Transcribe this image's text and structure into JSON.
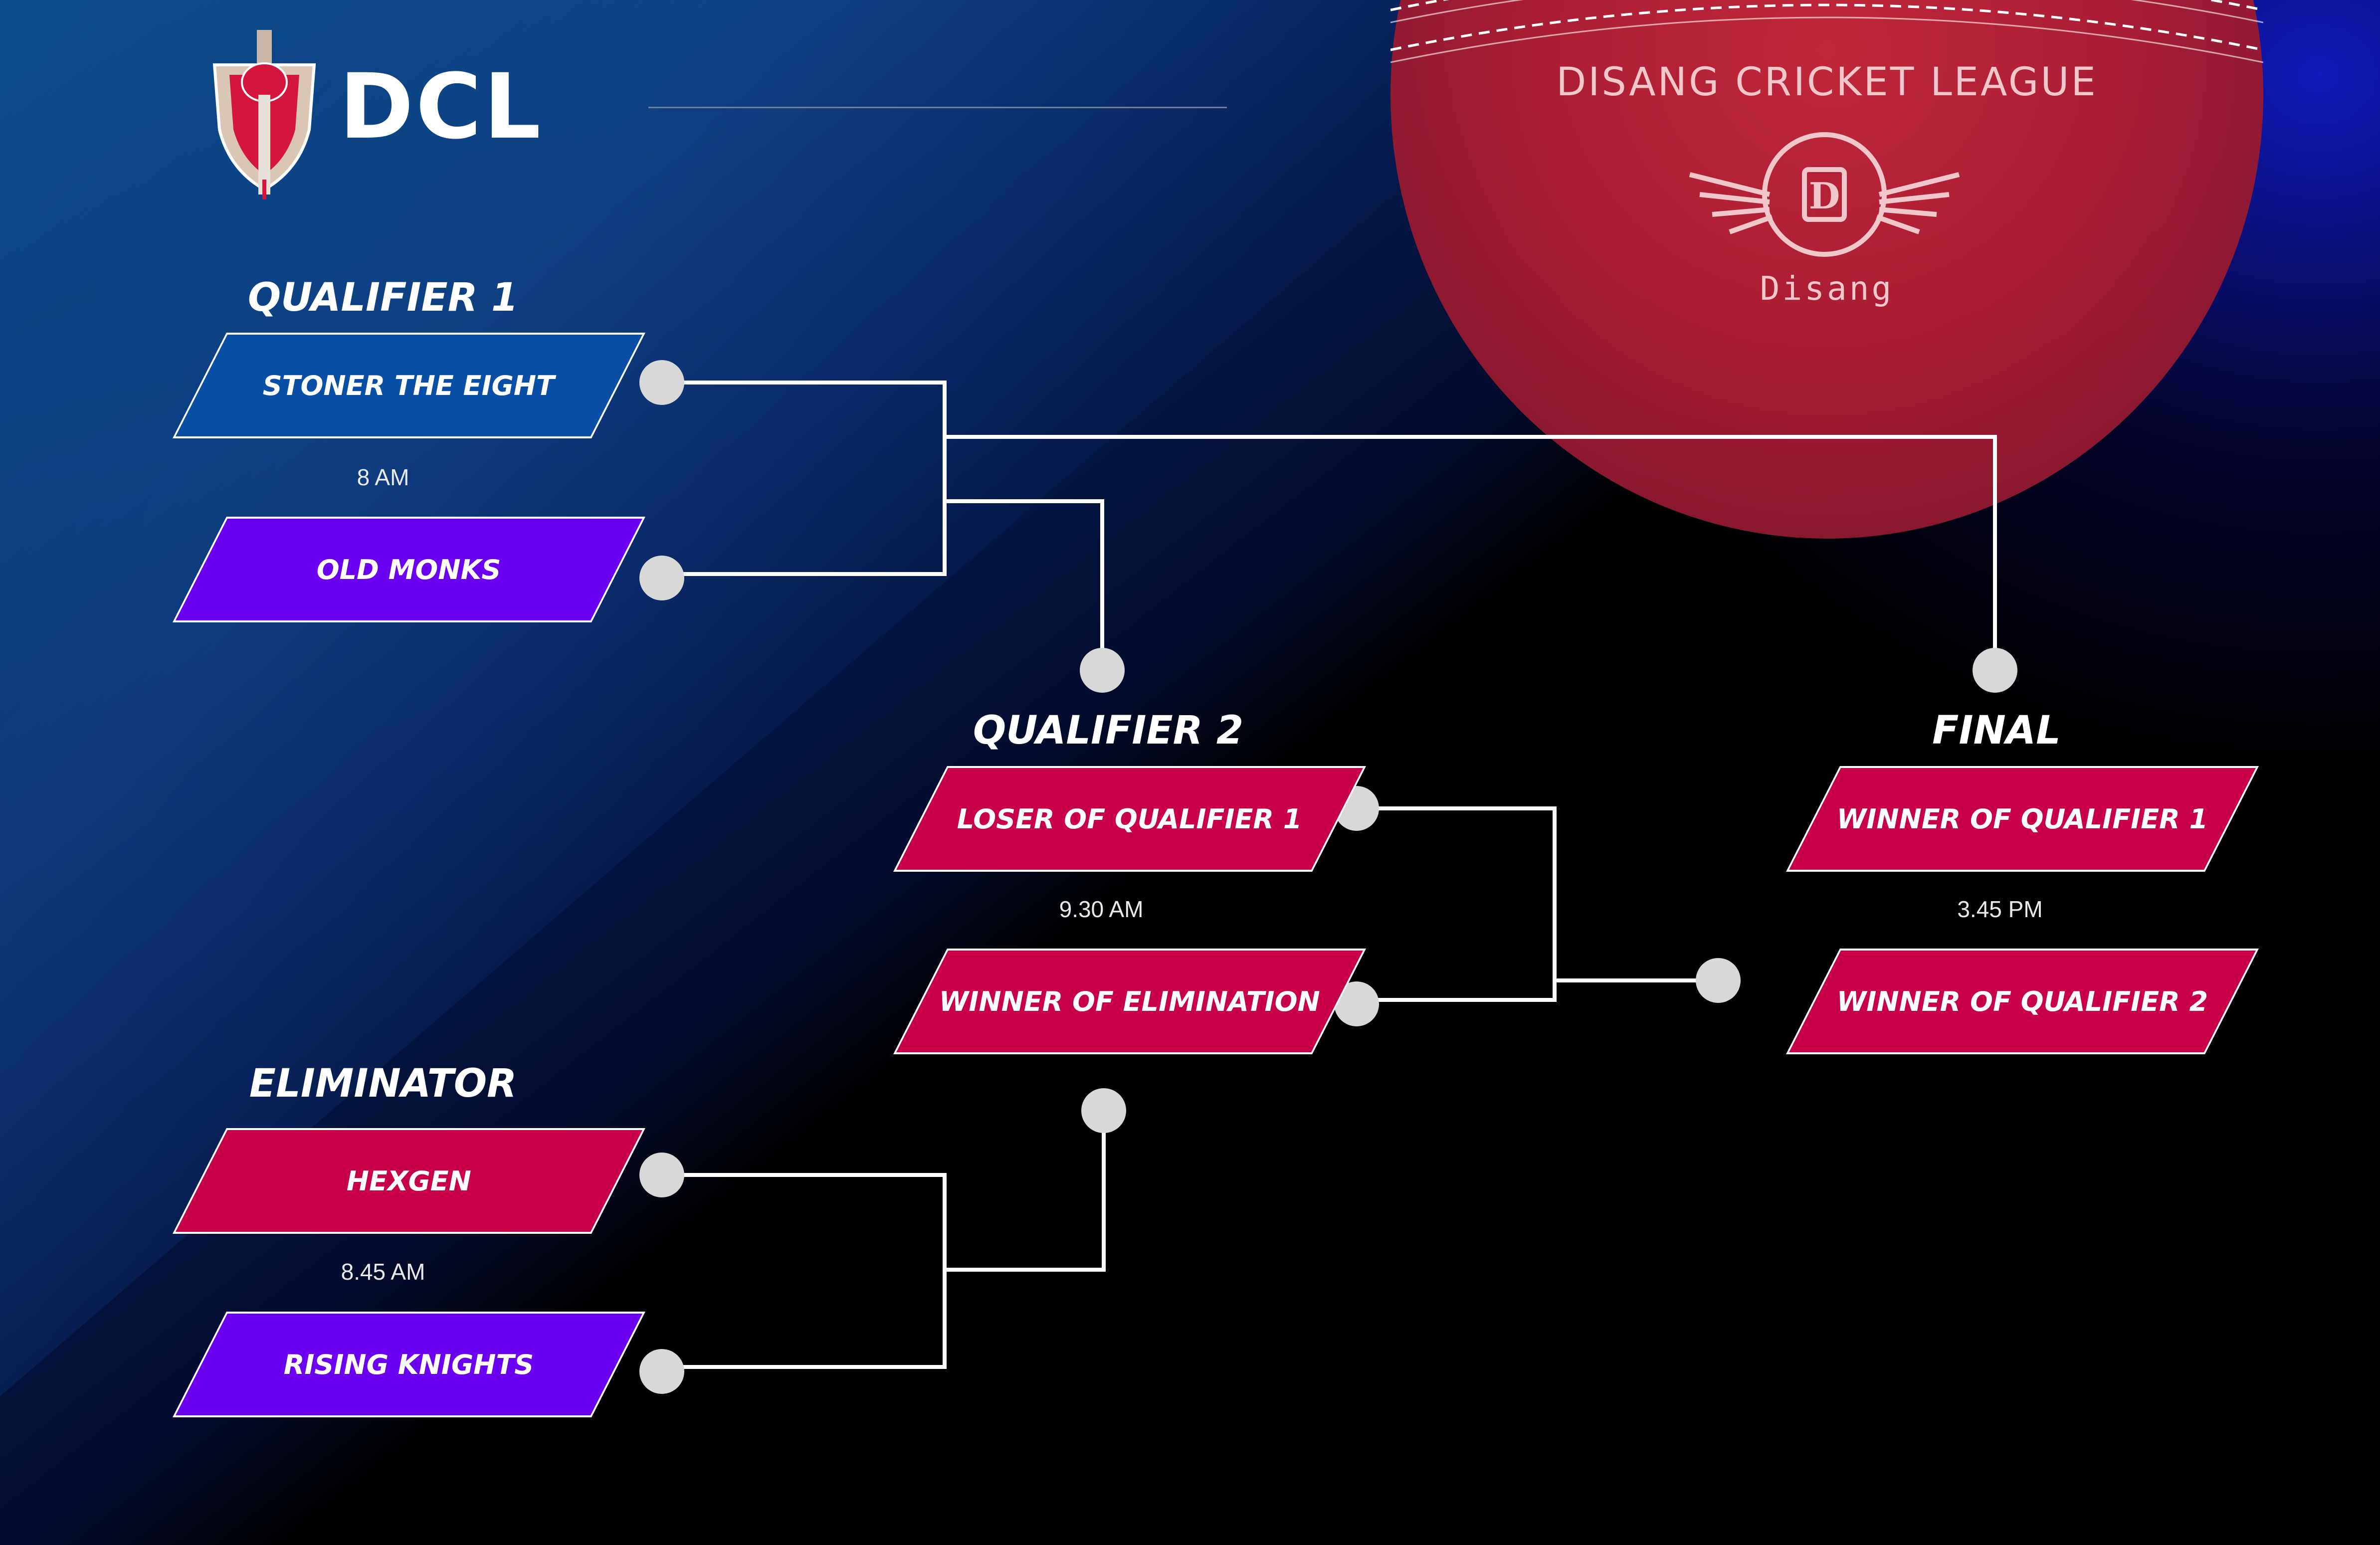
{
  "header": {
    "brand": "DCL"
  },
  "ball": {
    "league_name": "DISANG CRICKET LEAGUE",
    "emblem_text": "Disang",
    "colors": {
      "ball": "#b01e34",
      "seam": "#ffffff"
    }
  },
  "colors": {
    "team_blue": "#0a4fa6",
    "team_purple": "#6b00f0",
    "team_red": "#c8004a",
    "connector": "#ffffff",
    "node": "#d8d8d8"
  },
  "rounds": {
    "qualifier1": {
      "title": "QUALIFIER 1",
      "team_a": "STONER THE EIGHT",
      "time": "8 AM",
      "team_b": "OLD MONKS"
    },
    "qualifier2": {
      "title": "QUALIFIER 2",
      "team_a": "LOSER OF QUALIFIER 1",
      "time": "9.30 AM",
      "team_b": "WINNER OF ELIMINATION"
    },
    "final": {
      "title": "FINAL",
      "team_a": "WINNER OF QUALIFIER 1",
      "time": "3.45 PM",
      "team_b": "WINNER OF QUALIFIER 2"
    },
    "eliminator": {
      "title": "ELIMINATOR",
      "team_a": "HEXGEN",
      "time": "8.45 AM",
      "team_b": "RISING KNIGHTS"
    }
  }
}
